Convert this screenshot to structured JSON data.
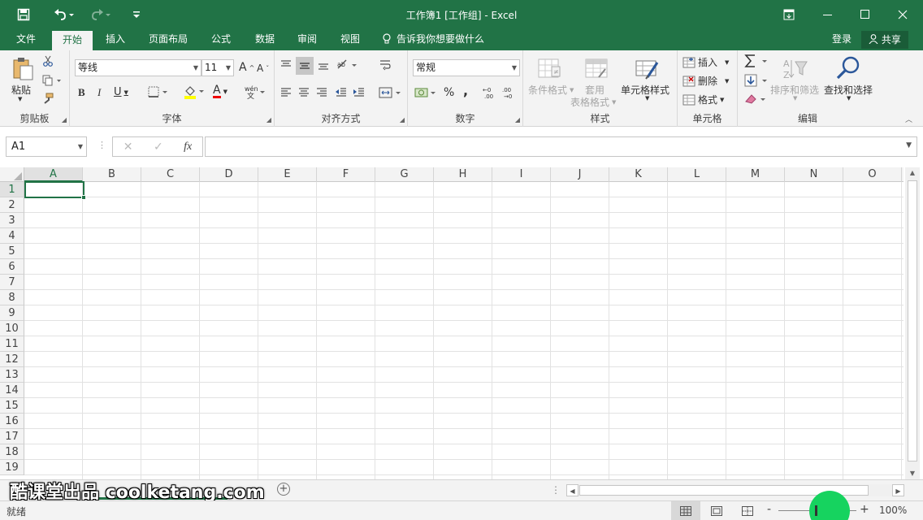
{
  "titlebar": {
    "title": "工作簿1 [工作组] - Excel",
    "icons": [
      "save-icon",
      "undo-icon",
      "redo-icon",
      "customize-qat-icon",
      "ribbon-display-icon",
      "minimize-icon",
      "maximize-icon",
      "close-icon"
    ]
  },
  "menu": {
    "tabs": [
      "文件",
      "开始",
      "插入",
      "页面布局",
      "公式",
      "数据",
      "审阅",
      "视图"
    ],
    "active": "开始",
    "tell_me": "告诉我你想要做什么",
    "login": "登录",
    "share": "共享"
  },
  "ribbon": {
    "clipboard": {
      "label": "剪贴板",
      "paste": "粘贴"
    },
    "font": {
      "label": "字体",
      "font_name": "等线",
      "font_size": "11",
      "bold": "B",
      "italic": "I",
      "underline": "U",
      "font_color": "A",
      "grow": "A",
      "shrink": "A"
    },
    "alignment": {
      "label": "对齐方式"
    },
    "number": {
      "label": "数字",
      "format": "常规",
      "percent": "%",
      "comma": ","
    },
    "styles": {
      "label": "样式",
      "conditional": "条件格式",
      "table_format_1": "套用",
      "table_format_2": "表格格式",
      "cell_styles": "单元格样式"
    },
    "cells": {
      "label": "单元格",
      "insert": "插入",
      "delete": "删除",
      "format": "格式"
    },
    "editing": {
      "label": "编辑",
      "sort_filter": "排序和筛选",
      "find_select": "查找和选择"
    }
  },
  "formula_bar": {
    "name_box": "A1",
    "fx": "fx",
    "value": ""
  },
  "grid": {
    "columns": [
      "A",
      "B",
      "C",
      "D",
      "E",
      "F",
      "G",
      "H",
      "I",
      "J",
      "K",
      "L",
      "M",
      "N",
      "O"
    ],
    "rows": [
      "1",
      "2",
      "3",
      "4",
      "5",
      "6",
      "7",
      "8",
      "9",
      "10",
      "11",
      "12",
      "13",
      "14",
      "15",
      "16",
      "17",
      "18",
      "19"
    ],
    "active_cell": "A1"
  },
  "sheet_tabs": {
    "watermark": "酷课堂出品 coolketang.com",
    "add": "+"
  },
  "status": {
    "text": "就绪",
    "zoom": "100%",
    "zoom_minus": "-",
    "zoom_plus": "+"
  },
  "colors": {
    "brand": "#217346",
    "ribbon_bg": "#f3f3f3",
    "grid_line": "#e2e2e2",
    "zoom_highlight": "#16d35f"
  }
}
